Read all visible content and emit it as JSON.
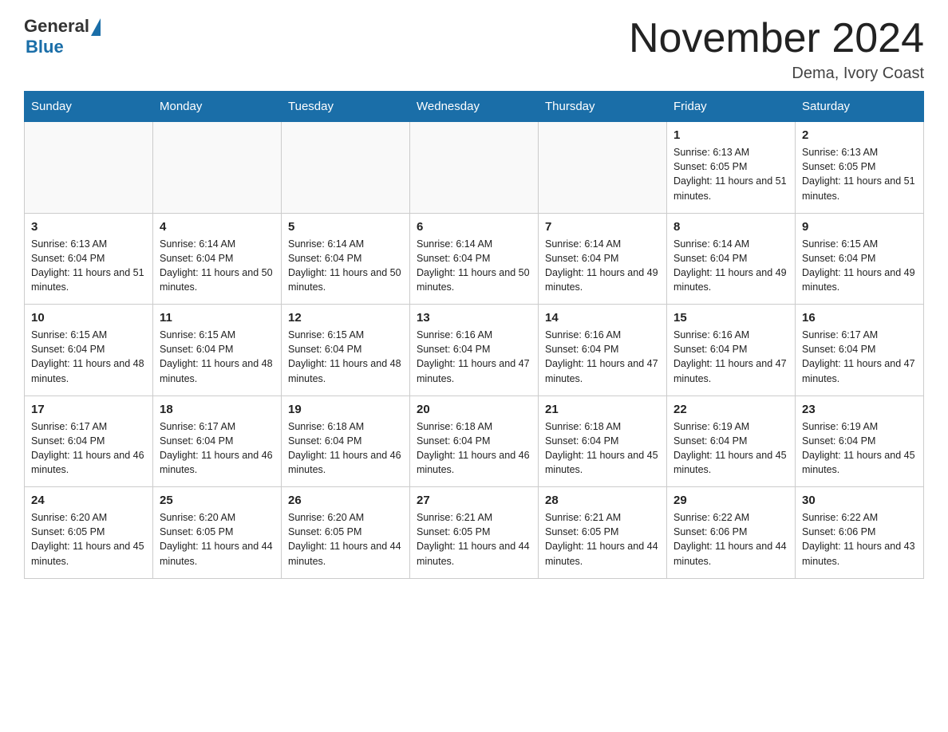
{
  "header": {
    "logo_general": "General",
    "logo_blue": "Blue",
    "month_title": "November 2024",
    "subtitle": "Dema, Ivory Coast"
  },
  "days_of_week": [
    "Sunday",
    "Monday",
    "Tuesday",
    "Wednesday",
    "Thursday",
    "Friday",
    "Saturday"
  ],
  "weeks": [
    [
      {
        "day": "",
        "info": ""
      },
      {
        "day": "",
        "info": ""
      },
      {
        "day": "",
        "info": ""
      },
      {
        "day": "",
        "info": ""
      },
      {
        "day": "",
        "info": ""
      },
      {
        "day": "1",
        "info": "Sunrise: 6:13 AM\nSunset: 6:05 PM\nDaylight: 11 hours and 51 minutes."
      },
      {
        "day": "2",
        "info": "Sunrise: 6:13 AM\nSunset: 6:05 PM\nDaylight: 11 hours and 51 minutes."
      }
    ],
    [
      {
        "day": "3",
        "info": "Sunrise: 6:13 AM\nSunset: 6:04 PM\nDaylight: 11 hours and 51 minutes."
      },
      {
        "day": "4",
        "info": "Sunrise: 6:14 AM\nSunset: 6:04 PM\nDaylight: 11 hours and 50 minutes."
      },
      {
        "day": "5",
        "info": "Sunrise: 6:14 AM\nSunset: 6:04 PM\nDaylight: 11 hours and 50 minutes."
      },
      {
        "day": "6",
        "info": "Sunrise: 6:14 AM\nSunset: 6:04 PM\nDaylight: 11 hours and 50 minutes."
      },
      {
        "day": "7",
        "info": "Sunrise: 6:14 AM\nSunset: 6:04 PM\nDaylight: 11 hours and 49 minutes."
      },
      {
        "day": "8",
        "info": "Sunrise: 6:14 AM\nSunset: 6:04 PM\nDaylight: 11 hours and 49 minutes."
      },
      {
        "day": "9",
        "info": "Sunrise: 6:15 AM\nSunset: 6:04 PM\nDaylight: 11 hours and 49 minutes."
      }
    ],
    [
      {
        "day": "10",
        "info": "Sunrise: 6:15 AM\nSunset: 6:04 PM\nDaylight: 11 hours and 48 minutes."
      },
      {
        "day": "11",
        "info": "Sunrise: 6:15 AM\nSunset: 6:04 PM\nDaylight: 11 hours and 48 minutes."
      },
      {
        "day": "12",
        "info": "Sunrise: 6:15 AM\nSunset: 6:04 PM\nDaylight: 11 hours and 48 minutes."
      },
      {
        "day": "13",
        "info": "Sunrise: 6:16 AM\nSunset: 6:04 PM\nDaylight: 11 hours and 47 minutes."
      },
      {
        "day": "14",
        "info": "Sunrise: 6:16 AM\nSunset: 6:04 PM\nDaylight: 11 hours and 47 minutes."
      },
      {
        "day": "15",
        "info": "Sunrise: 6:16 AM\nSunset: 6:04 PM\nDaylight: 11 hours and 47 minutes."
      },
      {
        "day": "16",
        "info": "Sunrise: 6:17 AM\nSunset: 6:04 PM\nDaylight: 11 hours and 47 minutes."
      }
    ],
    [
      {
        "day": "17",
        "info": "Sunrise: 6:17 AM\nSunset: 6:04 PM\nDaylight: 11 hours and 46 minutes."
      },
      {
        "day": "18",
        "info": "Sunrise: 6:17 AM\nSunset: 6:04 PM\nDaylight: 11 hours and 46 minutes."
      },
      {
        "day": "19",
        "info": "Sunrise: 6:18 AM\nSunset: 6:04 PM\nDaylight: 11 hours and 46 minutes."
      },
      {
        "day": "20",
        "info": "Sunrise: 6:18 AM\nSunset: 6:04 PM\nDaylight: 11 hours and 46 minutes."
      },
      {
        "day": "21",
        "info": "Sunrise: 6:18 AM\nSunset: 6:04 PM\nDaylight: 11 hours and 45 minutes."
      },
      {
        "day": "22",
        "info": "Sunrise: 6:19 AM\nSunset: 6:04 PM\nDaylight: 11 hours and 45 minutes."
      },
      {
        "day": "23",
        "info": "Sunrise: 6:19 AM\nSunset: 6:04 PM\nDaylight: 11 hours and 45 minutes."
      }
    ],
    [
      {
        "day": "24",
        "info": "Sunrise: 6:20 AM\nSunset: 6:05 PM\nDaylight: 11 hours and 45 minutes."
      },
      {
        "day": "25",
        "info": "Sunrise: 6:20 AM\nSunset: 6:05 PM\nDaylight: 11 hours and 44 minutes."
      },
      {
        "day": "26",
        "info": "Sunrise: 6:20 AM\nSunset: 6:05 PM\nDaylight: 11 hours and 44 minutes."
      },
      {
        "day": "27",
        "info": "Sunrise: 6:21 AM\nSunset: 6:05 PM\nDaylight: 11 hours and 44 minutes."
      },
      {
        "day": "28",
        "info": "Sunrise: 6:21 AM\nSunset: 6:05 PM\nDaylight: 11 hours and 44 minutes."
      },
      {
        "day": "29",
        "info": "Sunrise: 6:22 AM\nSunset: 6:06 PM\nDaylight: 11 hours and 44 minutes."
      },
      {
        "day": "30",
        "info": "Sunrise: 6:22 AM\nSunset: 6:06 PM\nDaylight: 11 hours and 43 minutes."
      }
    ]
  ]
}
